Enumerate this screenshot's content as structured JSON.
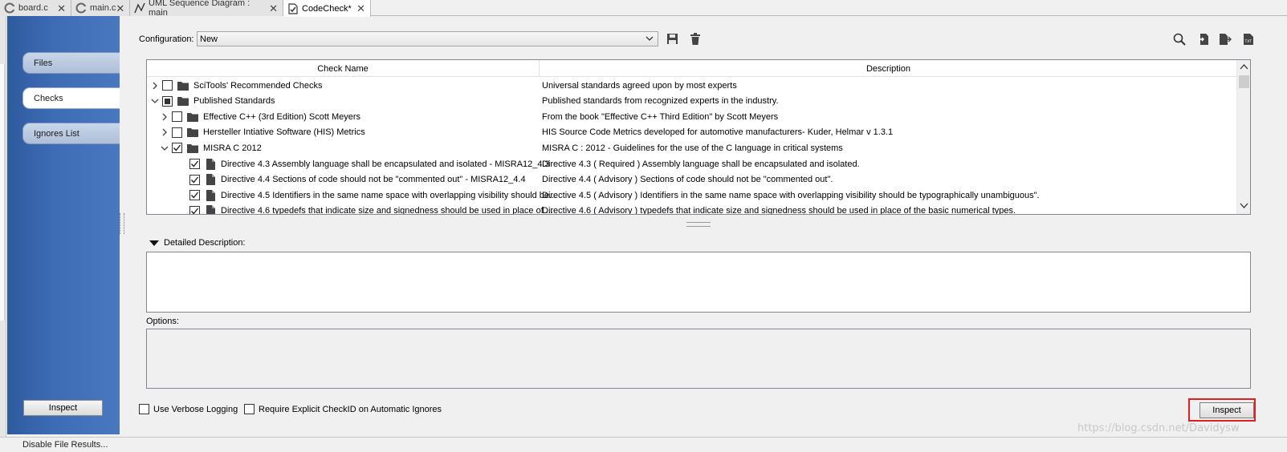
{
  "tabs": [
    {
      "label": "board.c",
      "icon": "c-file-icon"
    },
    {
      "label": "main.c",
      "icon": "c-file-icon"
    },
    {
      "label": "UML Sequence Diagram : main",
      "icon": "diagram-icon"
    },
    {
      "label": "CodeCheck*",
      "icon": "codecheck-icon"
    }
  ],
  "sidebar": {
    "items": [
      {
        "label": "Files"
      },
      {
        "label": "Checks"
      },
      {
        "label": "Ignores List"
      }
    ],
    "inspect_label": "Inspect"
  },
  "config": {
    "label": "Configuration:",
    "value": "New"
  },
  "tree": {
    "headers": {
      "name": "Check Name",
      "description": "Description"
    },
    "rows": [
      {
        "name": "SciTools' Recommended Checks",
        "description": "Universal standards agreed upon by most experts",
        "check": "unchecked",
        "expand": "collapsed",
        "type": "folder",
        "level": 0
      },
      {
        "name": "Published Standards",
        "description": "Published standards from recognized experts in the industry.",
        "check": "partial",
        "expand": "expanded",
        "type": "folder",
        "level": 0
      },
      {
        "name": "Effective C++ (3rd Edition) Scott Meyers",
        "description": "From the book \"Effective C++ Third Edition\" by Scott Meyers",
        "check": "unchecked",
        "expand": "collapsed",
        "type": "folder",
        "level": 1
      },
      {
        "name": "Hersteller Intiative Software (HIS) Metrics",
        "description": "HIS Source Code Metrics developed for automotive manufacturers- Kuder, Helmar v 1.3.1",
        "check": "unchecked",
        "expand": "collapsed",
        "type": "folder",
        "level": 1
      },
      {
        "name": "MISRA C 2012",
        "description": "MISRA C : 2012 - Guidelines for the use of the C language in critical systems",
        "check": "checked",
        "expand": "expanded",
        "type": "folder",
        "level": 1
      },
      {
        "name": "Directive 4.3 Assembly language shall be encapsulated and isolated - MISRA12_4.3",
        "description": "Directive 4.3 ( Required ) Assembly language shall be encapsulated and isolated.",
        "check": "checked",
        "expand": "none",
        "type": "file",
        "level": 2
      },
      {
        "name": "Directive 4.4 Sections of code should not be \"commented out\" - MISRA12_4.4",
        "description": "Directive 4.4 ( Advisory ) Sections of code should not be \"commented out\".",
        "check": "checked",
        "expand": "none",
        "type": "file",
        "level": 2
      },
      {
        "name": "Directive 4.5 Identifiers in the same name space with overlapping visibility should be...",
        "description": "Directive 4.5 ( Advisory ) Identifiers in the same name space with overlapping visibility should be typographically unambiguous\".",
        "check": "checked",
        "expand": "none",
        "type": "file",
        "level": 2
      },
      {
        "name": "Directive 4.6 typedefs that indicate size and signedness should be used in place of ...",
        "description": "Directive 4.6 ( Advisory ) typedefs that indicate size and signedness should be used in place of the basic numerical types.",
        "check": "checked",
        "expand": "none",
        "type": "file",
        "level": 2
      }
    ]
  },
  "detail": {
    "label": "Detailed Description:"
  },
  "options": {
    "label": "Options:"
  },
  "bottom": {
    "verbose_label": "Use Verbose Logging",
    "require_label": "Require Explicit CheckID on Automatic Ignores",
    "inspect_label": "Inspect"
  },
  "watermark": "https://blog.csdn.net/Davidysw",
  "status": "Disable File Results..."
}
